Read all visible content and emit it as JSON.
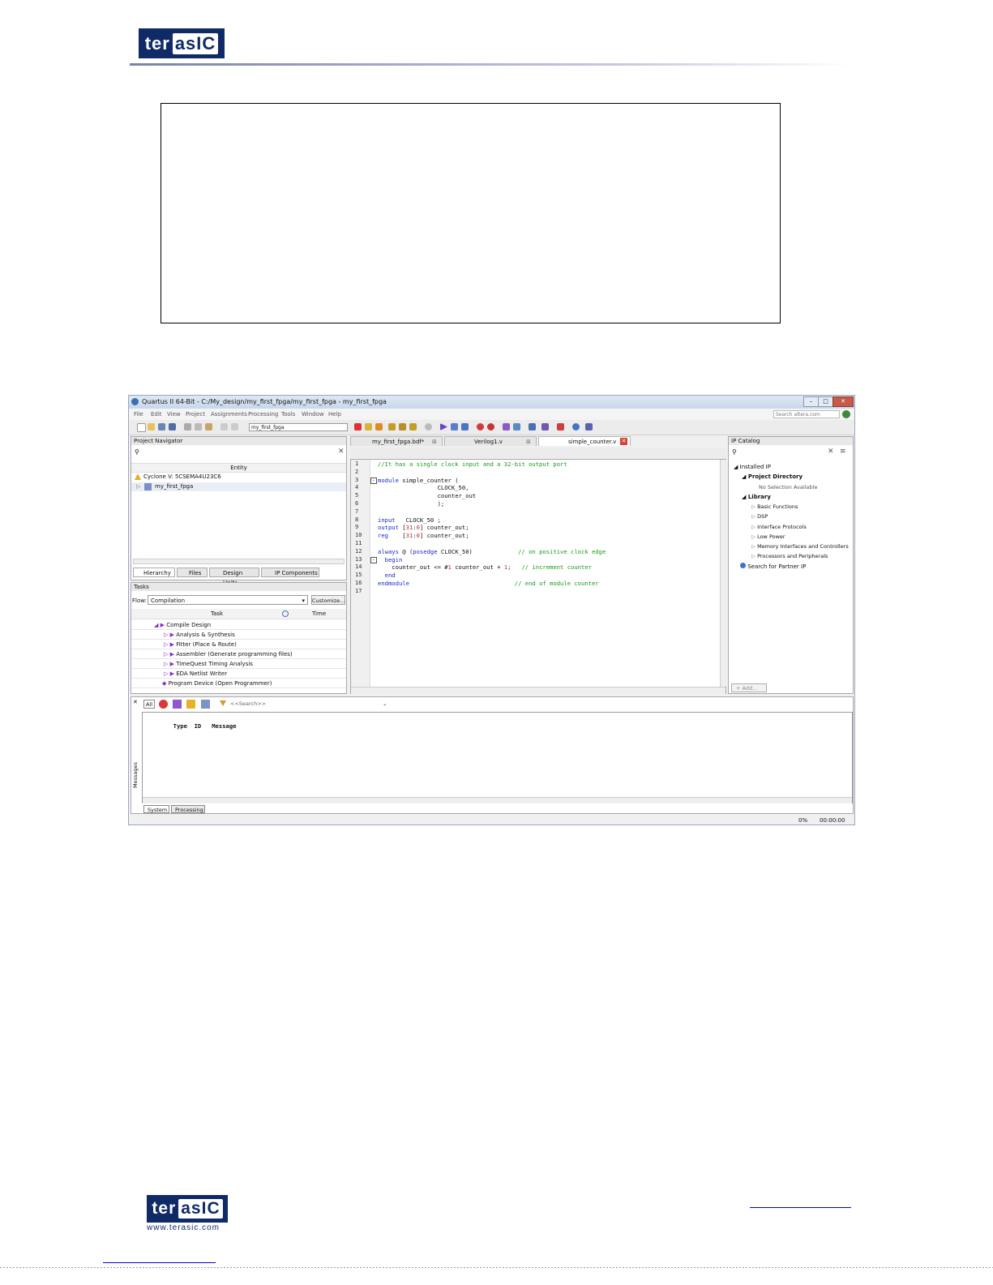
{
  "header": {
    "logo_main": "ter",
    "logo_box": "asIC"
  },
  "quartus": {
    "title": "Quartus II 64-Bit - C:/My_design/my_first_fpga/my_first_fpga - my_first_fpga",
    "menu": [
      "File",
      "Edit",
      "View",
      "Project",
      "Assignments",
      "Processing",
      "Tools",
      "Window",
      "Help"
    ],
    "search_placeholder": "Search altera.com",
    "toolbar_project": "my_first_fpga",
    "project_navigator": {
      "title": "Project Navigator",
      "column": "Entity",
      "device": "Cyclone V: 5CSEMA4U23C6",
      "top_entity": "my_first_fpga",
      "tabs": [
        "Hierarchy",
        "Files",
        "Design Units",
        "IP Components"
      ]
    },
    "tasks": {
      "title": "Tasks",
      "flow_label": "Flow:",
      "flow_value": "Compilation",
      "customize": "Customize...",
      "col_task": "Task",
      "col_time": "Time",
      "items": [
        {
          "label": "Compile Design",
          "level": 1
        },
        {
          "label": "Analysis & Synthesis",
          "level": 2
        },
        {
          "label": "Fitter (Place & Route)",
          "level": 2
        },
        {
          "label": "Assembler (Generate programming files)",
          "level": 2
        },
        {
          "label": "TimeQuest Timing Analysis",
          "level": 2
        },
        {
          "label": "EDA Netlist Writer",
          "level": 2
        },
        {
          "label": "Program Device (Open Programmer)",
          "level": 0
        }
      ]
    },
    "editor": {
      "tabs": [
        "my_first_fpga.bdf*",
        "Verilog1.v",
        "simple_counter.v"
      ],
      "line_numbers": [
        "1",
        "2",
        "3",
        "4",
        "5",
        "6",
        "7",
        "8",
        "9",
        "10",
        "11",
        "12",
        "13",
        "14",
        "15",
        "16",
        "17"
      ]
    },
    "ip_catalog": {
      "title": "IP Catalog",
      "installed": "Installed IP",
      "project_directory": "Project Directory",
      "no_selection": "No Selection Available",
      "library": "Library",
      "library_items": [
        "Basic Functions",
        "DSP",
        "Interface Protocols",
        "Low Power",
        "Memory Interfaces and Controllers",
        "Processors and Peripherals"
      ],
      "partner": "Search for Partner IP",
      "add": "Add..."
    },
    "messages": {
      "all": "All",
      "search": "<<Search>>",
      "col_type": "Type",
      "col_id": "ID",
      "col_message": "Message",
      "side_label": "Messages",
      "tabs": [
        "System",
        "Processing"
      ]
    },
    "status": {
      "percent": "0%",
      "time": "00:00:00"
    }
  },
  "footer": {
    "logo_main": "ter",
    "logo_box": "asIC",
    "url": "www.terasic.com"
  }
}
